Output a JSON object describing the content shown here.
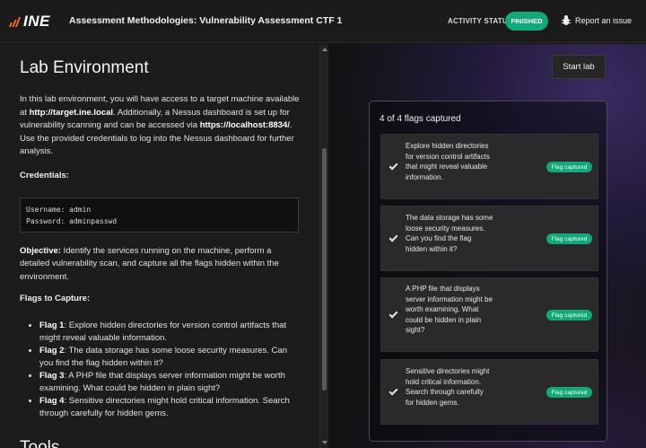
{
  "header": {
    "logo": "INE",
    "title": "Assessment Methodologies: Vulnerability Assessment CTF 1",
    "activity_status_label": "ACTIVITY STATUS:",
    "activity_status_value": "FINISHED",
    "report_label": "Report an issue"
  },
  "colors": {
    "accent_green": "#12a87a",
    "logo_orange": "#f26b1d"
  },
  "lab": {
    "title": "Lab Environment",
    "intro": {
      "p1": "In this lab environment, you will have access to a target machine available at ",
      "target": "http://target.ine.local",
      "p2": ". Additionally, a Nessus dashboard is set up for vulnerability scanning and can be accessed via ",
      "nessus": "https://localhost:8834/",
      "p3": ". Use the provided credentials to log into the Nessus dashboard for further analysis."
    },
    "credentials_label": "Credentials:",
    "credentials": {
      "username_line": "Username: admin",
      "password_line": "Password: adminpasswd"
    },
    "objective_label": "Objective:",
    "objective_text": " Identify the services running on the machine, perform a detailed vulnerability scan, and capture all the flags hidden within the environment.",
    "flags_to_capture_label": "Flags to Capture:",
    "flags": [
      {
        "label": "Flag 1",
        "text": ": Explore hidden directories for version control artifacts that might reveal valuable information."
      },
      {
        "label": "Flag 2",
        "text": ": The data storage has some loose security measures. Can you find the flag hidden within it?"
      },
      {
        "label": "Flag 3",
        "text": ": A PHP file that displays server information might be worth examining. What could be hidden in plain sight?"
      },
      {
        "label": "Flag 4",
        "text": ": Sensitive directories might hold critical information. Search through carefully for hidden gems."
      }
    ],
    "tools_title": "Tools"
  },
  "right": {
    "start_lab_label": "Start lab",
    "flags_count": "4 of 4 flags captured",
    "items": [
      {
        "text": "Explore hidden directories for version control artifacts that might reveal valuable information.",
        "badge": "Flag captured"
      },
      {
        "text": "The data storage has some loose security measures. Can you find the flag hidden within it?",
        "badge": "Flag captured"
      },
      {
        "text": "A PHP file that displays server information might be worth examining. What could be hidden in plain sight?",
        "badge": "Flag captured"
      },
      {
        "text": "Sensitive directories might hold critical information. Search through carefully for hidden gems.",
        "badge": "Flag captured"
      }
    ]
  }
}
